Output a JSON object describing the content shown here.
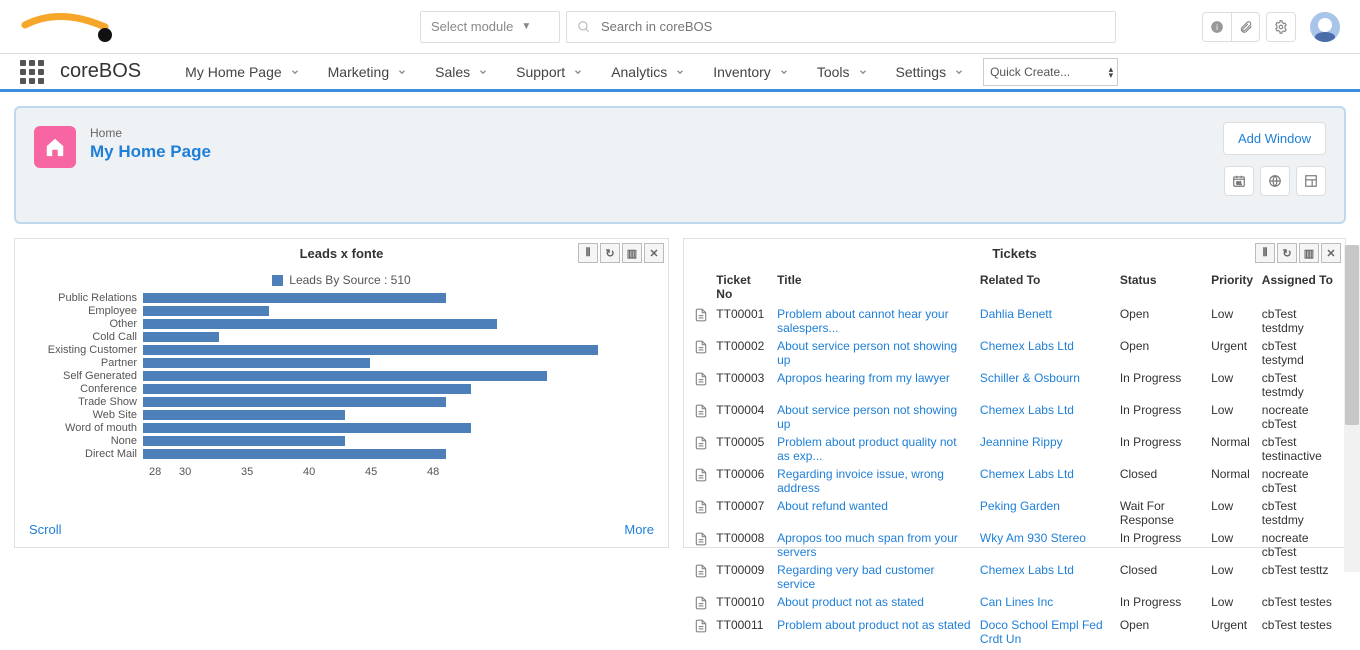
{
  "topbar": {
    "module_select": "Select module",
    "search_placeholder": "Search in coreBOS"
  },
  "menubar": {
    "brand": "coreBOS",
    "items": [
      "My Home Page",
      "Marketing",
      "Sales",
      "Support",
      "Analytics",
      "Inventory",
      "Tools",
      "Settings"
    ],
    "quick_create": "Quick Create..."
  },
  "banner": {
    "crumb": "Home",
    "title": "My Home Page",
    "add_window": "Add Window"
  },
  "widget_left": {
    "title": "Leads x fonte",
    "legend": "Leads By Source : 510",
    "scroll": "Scroll",
    "more": "More",
    "xticks": [
      "28",
      "30",
      "35",
      "40",
      "45",
      "48"
    ]
  },
  "chart_data": {
    "type": "bar",
    "orientation": "horizontal",
    "title": "Leads x fonte",
    "legend": "Leads By Source : 510",
    "xlabel": "",
    "ylabel": "",
    "xlim": [
      28,
      48
    ],
    "categories": [
      "Public Relations",
      "Employee",
      "Other",
      "Cold Call",
      "Existing Customer",
      "Partner",
      "Self Generated",
      "Conference",
      "Trade Show",
      "Web Site",
      "Word of mouth",
      "None",
      "Direct Mail"
    ],
    "values": [
      40,
      33,
      42,
      31,
      46,
      37,
      44,
      41,
      40,
      36,
      41,
      36,
      40
    ]
  },
  "widget_right": {
    "title": "Tickets",
    "columns": [
      "Ticket No",
      "Title",
      "Related To",
      "Status",
      "Priority",
      "Assigned To"
    ],
    "rows": [
      {
        "no": "TT00001",
        "title": "Problem about cannot hear your salespers...",
        "rel": "Dahlia Benett",
        "status": "Open",
        "prio": "Low",
        "assigned": "cbTest testdmy"
      },
      {
        "no": "TT00002",
        "title": "About service person not showing up",
        "rel": "Chemex Labs Ltd",
        "status": "Open",
        "prio": "Urgent",
        "assigned": "cbTest testymd"
      },
      {
        "no": "TT00003",
        "title": "Apropos hearing from my lawyer",
        "rel": "Schiller & Osbourn",
        "status": "In Progress",
        "prio": "Low",
        "assigned": "cbTest testmdy"
      },
      {
        "no": "TT00004",
        "title": "About service person not showing up",
        "rel": "Chemex Labs Ltd",
        "status": "In Progress",
        "prio": "Low",
        "assigned": "nocreate cbTest"
      },
      {
        "no": "TT00005",
        "title": "Problem about product quality not as exp...",
        "rel": "Jeannine Rippy",
        "status": "In Progress",
        "prio": "Normal",
        "assigned": "cbTest testinactive"
      },
      {
        "no": "TT00006",
        "title": "Regarding invoice issue, wrong address",
        "rel": "Chemex Labs Ltd",
        "status": "Closed",
        "prio": "Normal",
        "assigned": "nocreate cbTest"
      },
      {
        "no": "TT00007",
        "title": "About refund wanted",
        "rel": "Peking Garden",
        "status": "Wait For Response",
        "prio": "Low",
        "assigned": "cbTest testdmy"
      },
      {
        "no": "TT00008",
        "title": "Apropos too much span from your servers",
        "rel": "Wky Am 930 Stereo",
        "status": "In Progress",
        "prio": "Low",
        "assigned": "nocreate cbTest"
      },
      {
        "no": "TT00009",
        "title": "Regarding very bad customer service",
        "rel": "Chemex Labs Ltd",
        "status": "Closed",
        "prio": "Low",
        "assigned": "cbTest testtz"
      },
      {
        "no": "TT00010",
        "title": "About product not as stated",
        "rel": "Can Lines Inc",
        "status": "In Progress",
        "prio": "Low",
        "assigned": "cbTest testes"
      },
      {
        "no": "TT00011",
        "title": "Problem about product not as stated",
        "rel": "Doco School Empl Fed Crdt Un",
        "status": "Open",
        "prio": "Urgent",
        "assigned": "cbTest testes"
      }
    ]
  }
}
